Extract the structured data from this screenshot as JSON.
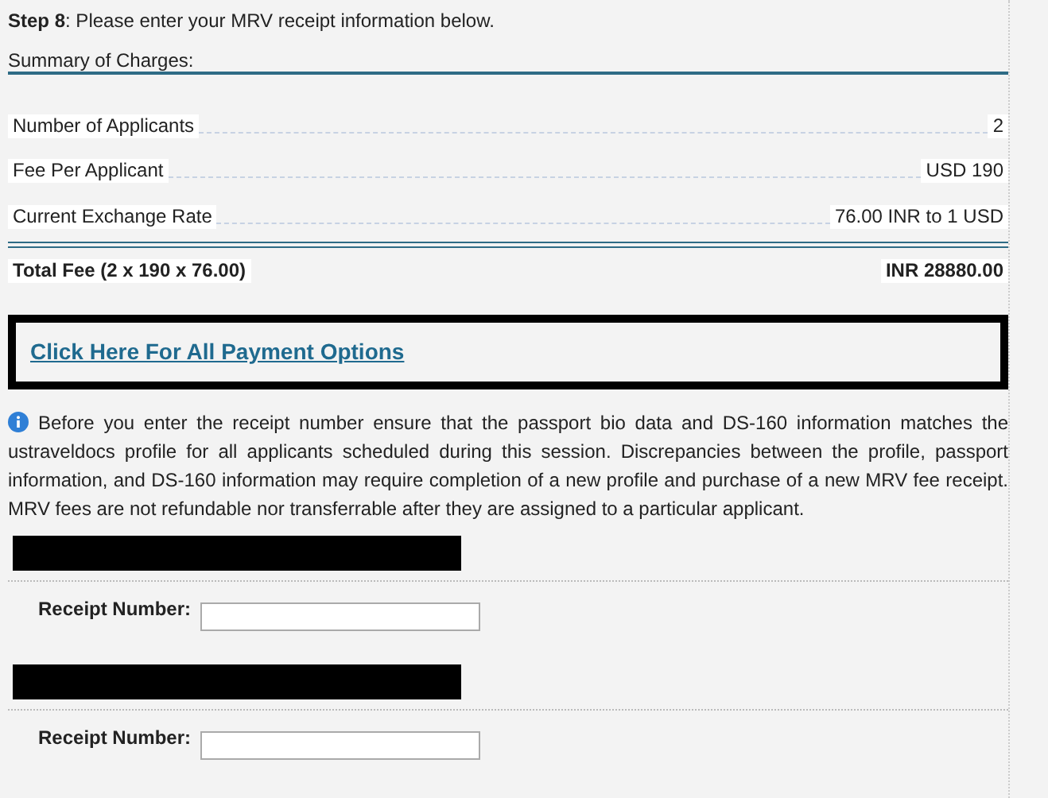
{
  "step": {
    "label": "Step 8",
    "text": ": Please enter your MRV receipt information below."
  },
  "summary": {
    "title": "Summary of Charges:",
    "rows": [
      {
        "label": "Number of Applicants",
        "value": "2"
      },
      {
        "label": "Fee Per Applicant",
        "value": "USD 190"
      },
      {
        "label": "Current Exchange Rate",
        "value": "76.00 INR to 1 USD"
      }
    ],
    "total": {
      "label": "Total Fee (2 x 190 x 76.00)",
      "value": "INR 28880.00"
    }
  },
  "payment_link": "Click Here For All Payment Options",
  "info_note": "Before you enter the receipt number ensure that the passport bio data and DS-160 information matches the ustraveldocs profile for all applicants scheduled during this session. Discrepancies between the profile, passport information, and DS-160 information may require completion of a new profile and purchase of a new MRV fee receipt. MRV fees are not refundable nor transferrable after they are assigned to a particular applicant.",
  "applicants": [
    {
      "receipt_label": "Receipt Number:"
    },
    {
      "receipt_label": "Receipt Number:"
    }
  ]
}
